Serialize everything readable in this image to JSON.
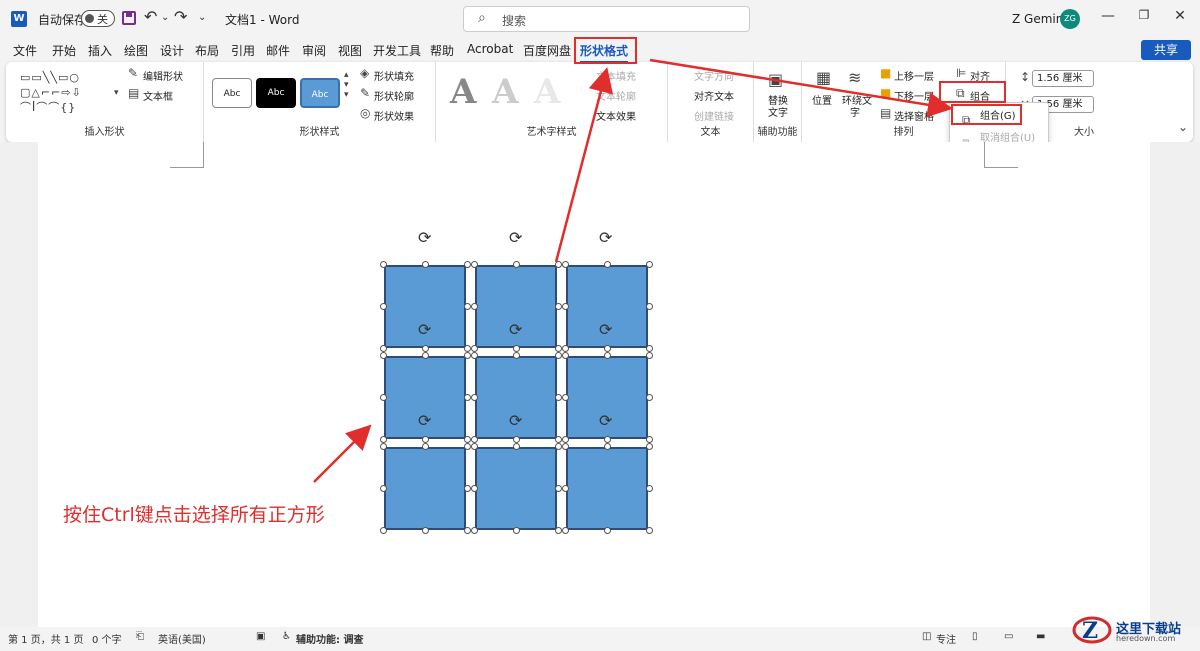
{
  "titlebar": {
    "autosave_label": "自动保存",
    "autosave_state": "关",
    "doc_title": "文档1 - Word",
    "search_placeholder": "搜索",
    "user_name": "Z Gemini",
    "user_initials": "ZG"
  },
  "menu": [
    "文件",
    "开始",
    "插入",
    "绘图",
    "设计",
    "布局",
    "引用",
    "邮件",
    "审阅",
    "视图",
    "开发工具",
    "帮助",
    "Acrobat",
    "百度网盘",
    "形状格式"
  ],
  "share_label": "共享",
  "ribbon": {
    "insert_shape": {
      "label": "插入形状",
      "edit_shape": "编辑形状",
      "textbox": "文本框"
    },
    "shape_styles": {
      "label": "形状样式",
      "sample": "Abc",
      "fill": "形状填充",
      "outline": "形状轮廓",
      "effects": "形状效果"
    },
    "art_styles": {
      "label": "艺术字样式",
      "glyph": "A",
      "text_fill": "文本填充",
      "text_outline": "文本轮廓",
      "text_effects": "文本效果"
    },
    "text": {
      "label": "文本",
      "direction": "文字方向",
      "align": "对齐文本",
      "link": "创建链接"
    },
    "accessibility": {
      "label": "辅助功能",
      "alt_text_1": "替换",
      "alt_text_2": "文字"
    },
    "arrange": {
      "label": "排列",
      "position": "位置",
      "wrap_1": "环绕文",
      "wrap_2": "字",
      "forward": "上移一层",
      "backward": "下移一层",
      "pane": "选择窗格",
      "align": "对齐",
      "group": "组合"
    },
    "size": {
      "label": "大小",
      "height": "1.56 厘米",
      "width": "1.56 厘米"
    }
  },
  "group_dropdown": {
    "group": "组合(G)",
    "ungroup": "取消组合(U)"
  },
  "annotation": "按住Ctrl键点击选择所有正方形",
  "statusbar": {
    "page": "第 1 页，共 1 页",
    "words": "0 个字",
    "lang": "英语(美国)",
    "accessibility": "辅助功能: 调查",
    "focus": "专注"
  },
  "watermark": {
    "title": "这里下载站",
    "url": "heredown.com"
  },
  "colors": {
    "accent": "#185abd",
    "shape_fill": "#5b9bd5",
    "highlight": "#e22d2d"
  }
}
